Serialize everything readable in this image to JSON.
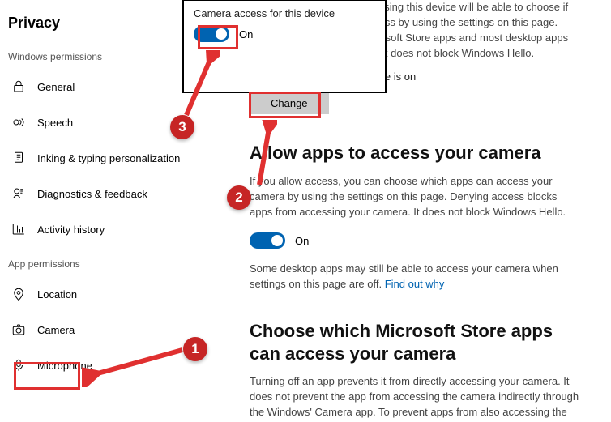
{
  "sidebar": {
    "title": "Privacy",
    "windows_permissions_header": "Windows permissions",
    "app_permissions_header": "App permissions",
    "items": {
      "general": "General",
      "speech": "Speech",
      "inking": "Inking & typing personalization",
      "diagnostics": "Diagnostics & feedback",
      "activity": "Activity history",
      "location": "Location",
      "camera": "Camera",
      "microphone": "Microphone"
    }
  },
  "content": {
    "device_para": "If you allow access, people using this device will be able to choose if their apps have camera access by using the settings on this page. Denying access blocks Microsoft Store apps and most desktop apps from accessing the camera. It does not block Windows Hello.",
    "device_state_prefix": "Camera access for this device ",
    "device_state_value": "is on",
    "change_btn": "Change",
    "allow_heading": "Allow apps to access your camera",
    "allow_para": "If you allow access, you can choose which apps can access your camera by using the settings on this page. Denying access blocks apps from accessing your camera. It does not block Windows Hello.",
    "toggle_label": "On",
    "desktop_note_prefix": "Some desktop apps may still be able to access your camera when settings on this page are off. ",
    "find_out_why": "Find out why",
    "choose_heading": "Choose which Microsoft Store apps can access your camera",
    "choose_para": "Turning off an app prevents it from directly accessing your camera. It does not prevent the app from accessing the camera indirectly through the Windows' Camera app. To prevent apps from also accessing the"
  },
  "popup": {
    "title": "Camera access for this device",
    "toggle_label": "On"
  },
  "annotations": {
    "badge1": "1",
    "badge2": "2",
    "badge3": "3"
  }
}
